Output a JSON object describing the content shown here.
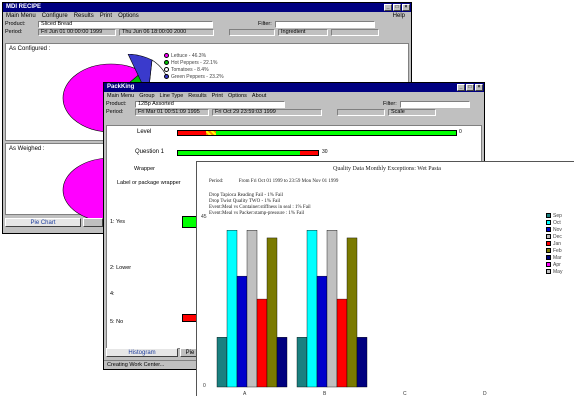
{
  "win1": {
    "title": "MDI RECIPE",
    "menu": [
      "Main Menu",
      "Configure",
      "Results",
      "Print",
      "Options"
    ],
    "help": "Help",
    "product_label": "Product:",
    "product_value": "Sliced Bread",
    "filter_label": "Filter:",
    "period_label": "Period:",
    "period_from": "Fri Jun 01 00:00:00 1999",
    "period_to": "Thu Jun 06 18:00:00 2000",
    "ingredient": "Ingredient",
    "configured_label": "As Configured :",
    "weighed_label": "As Weighed :",
    "pie_legend": [
      {
        "label": "Lettuce - 46.3%",
        "color": "#ff00ff"
      },
      {
        "label": "Hot Peppers - 22.1%",
        "color": "#00c000"
      },
      {
        "label": "Tomatoes - 8.4%",
        "color": "#ffffff"
      },
      {
        "label": "Green Peppers - 23.2%",
        "color": "#3a3acc"
      }
    ],
    "pie_configured": [
      46.3,
      22.1,
      8.4,
      23.2
    ],
    "tab_pie": "Pie Chart"
  },
  "win2": {
    "title": "PackKing",
    "menu": [
      "Main Menu",
      "Group",
      "Line Type",
      "Results",
      "Print",
      "Options",
      "About"
    ],
    "product_label": "Product:",
    "product_value": "12Bp Assorted",
    "filter_label": "Filter:",
    "period_label": "Period:",
    "period_from": "Fri Mar 01 00:51:09 1995",
    "period_to": "Fri Oct 29 23:59:03 1999",
    "scale": "Scale",
    "rows": [
      {
        "label": "Level",
        "red": 0.12,
        "checked": 0.03,
        "green": 0.85,
        "value": "0"
      },
      {
        "label": "Question 1",
        "red": 0,
        "checked": 0,
        "green": 0.88,
        "redTail": 0.12,
        "value": "30"
      },
      {
        "label": "Wrapper",
        "red": 0,
        "checked": 0,
        "green": 0,
        "value": ""
      },
      {
        "label": "Label or package wrapper",
        "red": 0,
        "checked": 0,
        "green": 0,
        "value": ""
      }
    ],
    "left_labels": [
      "1: Yes",
      "2: Lower",
      "4:",
      "5: No"
    ],
    "tab_histogram": "Histogram",
    "tab_pie": "Pie",
    "status": "Creating Work Center..."
  },
  "win3": {
    "title": "Quality Data Monthly Exceptions: Wet Pasta",
    "period_label": "Period:",
    "period_value": "From Fri Oct 01 1999 to 23:59 Mon Nov 01 1999",
    "lines": [
      "Drop Tapioca Reading Fail - 1% Fail",
      "Drop Twist Quality TWO - 1% Fail",
      "Event:Meal vs Container:stiffness in seal : 1% Fail",
      "Event:Meal vs Packer:stamp-pressure : 1% Fail"
    ],
    "y_max": "45",
    "y_min": "0",
    "x_labels": [
      "A",
      "B",
      "C",
      "D"
    ],
    "legend": [
      {
        "label": "Sep",
        "color": "#1a8080"
      },
      {
        "label": "Oct",
        "color": "#00ffff"
      },
      {
        "label": "Nov",
        "color": "#0000cc"
      },
      {
        "label": "Dec",
        "color": "#c0c0c0"
      },
      {
        "label": "Jan",
        "color": "#ff0000"
      },
      {
        "label": "Feb",
        "color": "#7a7a00"
      },
      {
        "label": "Mar",
        "color": "#000080"
      },
      {
        "label": "Apr",
        "color": "#ff00ff"
      },
      {
        "label": "May",
        "color": "#c0c0c0"
      }
    ]
  },
  "chart_data": {
    "type": "bar",
    "categories": [
      "A",
      "B",
      "C",
      "D"
    ],
    "series": [
      {
        "name": "Sep",
        "values": [
          13,
          13,
          0,
          0
        ]
      },
      {
        "name": "Oct",
        "values": [
          41,
          41,
          0,
          0
        ]
      },
      {
        "name": "Nov",
        "values": [
          29,
          29,
          0,
          0
        ]
      },
      {
        "name": "Dec",
        "values": [
          41,
          41,
          0,
          0
        ]
      },
      {
        "name": "Jan",
        "values": [
          23,
          23,
          0,
          0
        ]
      },
      {
        "name": "Feb",
        "values": [
          39,
          39,
          0,
          0
        ]
      },
      {
        "name": "Mar",
        "values": [
          13,
          13,
          0,
          0
        ]
      }
    ],
    "ylim": [
      0,
      45
    ],
    "title": "Quality Data Monthly Exceptions: Wet Pasta"
  }
}
